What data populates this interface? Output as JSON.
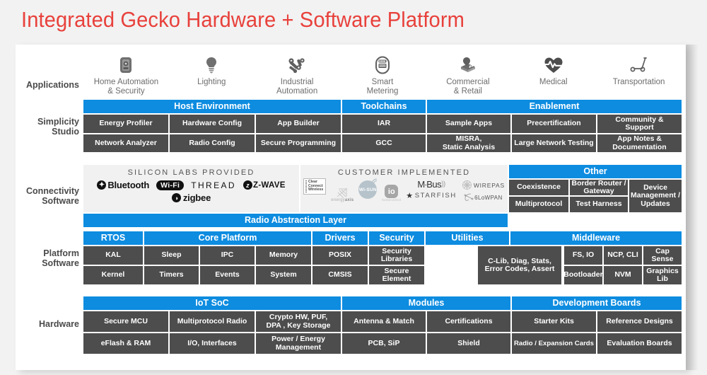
{
  "title": "Integrated Gecko Hardware + Software Platform",
  "colors": {
    "accent_blue": "#0d8ce0",
    "cell_gray": "#4d4d4d",
    "title_red": "#e8413c",
    "panel_bg": "#ffffff",
    "page_bg": "#f2f2f2"
  },
  "rows": {
    "applications": {
      "label": "Applications",
      "items": [
        {
          "icon": "smart-home-panel-icon",
          "label": "Home Automation\n& Security",
          "line1": "Home Automation",
          "line2": "& Security"
        },
        {
          "icon": "light-bulb-icon",
          "label": "Lighting",
          "line1": "Lighting",
          "line2": ""
        },
        {
          "icon": "robot-arm-icon",
          "label": "Industrial Automation",
          "line1": "Industrial",
          "line2": "Automation"
        },
        {
          "icon": "utility-meter-icon",
          "label": "Smart Metering",
          "line1": "Smart",
          "line2": "Metering"
        },
        {
          "icon": "retail-scanner-icon",
          "label": "Commercial & Retail",
          "line1": "Commercial",
          "line2": "& Retail"
        },
        {
          "icon": "heartbeat-icon",
          "label": "Medical",
          "line1": "Medical",
          "line2": ""
        },
        {
          "icon": "scooter-icon",
          "label": "Transportation",
          "line1": "Transportation",
          "line2": ""
        }
      ]
    },
    "simplicity_studio": {
      "label": "Simplicity\nStudio",
      "label_line1": "Simplicity",
      "label_line2": "Studio",
      "headers": [
        {
          "text": "Host Environment",
          "span": 3
        },
        {
          "text": "Toolchains",
          "span": 1
        },
        {
          "text": "Enablement",
          "span": 3
        }
      ],
      "row1": [
        "Energy Profiler",
        "Hardware Config",
        "App Builder",
        "IAR",
        "Sample Apps",
        "Precertification",
        "Community &\nSupport"
      ],
      "row2": [
        "Network Analyzer",
        "Radio Config",
        "Secure Programming",
        "GCC",
        "MISRA,\nStatic Analysis",
        "Large Network Testing",
        "App Notes &\nDocumentation"
      ]
    },
    "connectivity_software": {
      "label": "Connectivity\nSoftware",
      "label_line1": "Connectivity",
      "label_line2": "Software",
      "silicon_labs_title": "SILICON LABS PROVIDED",
      "silicon_labs_logos": [
        "Bluetooth",
        "Wi-Fi",
        "THREAD",
        "Z-WAVE",
        "zigbee"
      ],
      "customer_title": "CUSTOMER IMPLEMENTED",
      "customer_logos": [
        "Clear Connect Wireless",
        "energyaxis",
        "Wi-SUN",
        "io homecontrol",
        "M-Bus",
        "WIREPAS",
        "STARFISH",
        "6LoWPAN"
      ],
      "radio_abstraction_layer": "Radio Abstraction Layer",
      "other_header": "Other",
      "other_row1": [
        "Coexistence",
        "Border Router /\nGateway"
      ],
      "other_row2": [
        "Multiprotocol",
        "Test Harness"
      ],
      "other_tall": "Device\nManagement /\nUpdates"
    },
    "platform_software": {
      "label": "Platform\nSoftware",
      "label_line1": "Platform",
      "label_line2": "Software",
      "headers": [
        {
          "text": "RTOS",
          "span": 1
        },
        {
          "text": "Core Platform",
          "span": 3
        },
        {
          "text": "Drivers",
          "span": 1
        },
        {
          "text": "Security",
          "span": 1
        },
        {
          "text": "Utilities",
          "span": 1
        },
        {
          "text": "Middleware",
          "span": 3
        }
      ],
      "row1": [
        "KAL",
        "Sleep",
        "IPC",
        "Memory",
        "POSIX",
        "Security\nLibraries",
        "FS, IO",
        "NCP, CLI",
        "Cap Sense"
      ],
      "row2": [
        "Kernel",
        "Timers",
        "Events",
        "System",
        "CMSIS",
        "Secure\nElement",
        "Bootloader",
        "NVM",
        "Graphics Lib"
      ],
      "utilities_tall": "C-Lib, Diag, Stats,\nError Codes, Assert"
    },
    "hardware": {
      "label": "Hardware",
      "headers": [
        {
          "text": "IoT SoC",
          "span": 3
        },
        {
          "text": "Modules",
          "span": 2
        },
        {
          "text": "Development Boards",
          "span": 2
        }
      ],
      "row1": [
        "Secure MCU",
        "Multiprotocol Radio",
        "Crypto HW, PUF,\nDPA , Key Storage",
        "Antenna & Match",
        "Certifications",
        "Starter Kits",
        "Reference Designs"
      ],
      "row2": [
        "eFlash & RAM",
        "I/O, Interfaces",
        "Power / Energy\nManagement",
        "PCB, SiP",
        "Shield",
        "Radio / Expansion Cards",
        "Evaluation Boards"
      ]
    }
  }
}
